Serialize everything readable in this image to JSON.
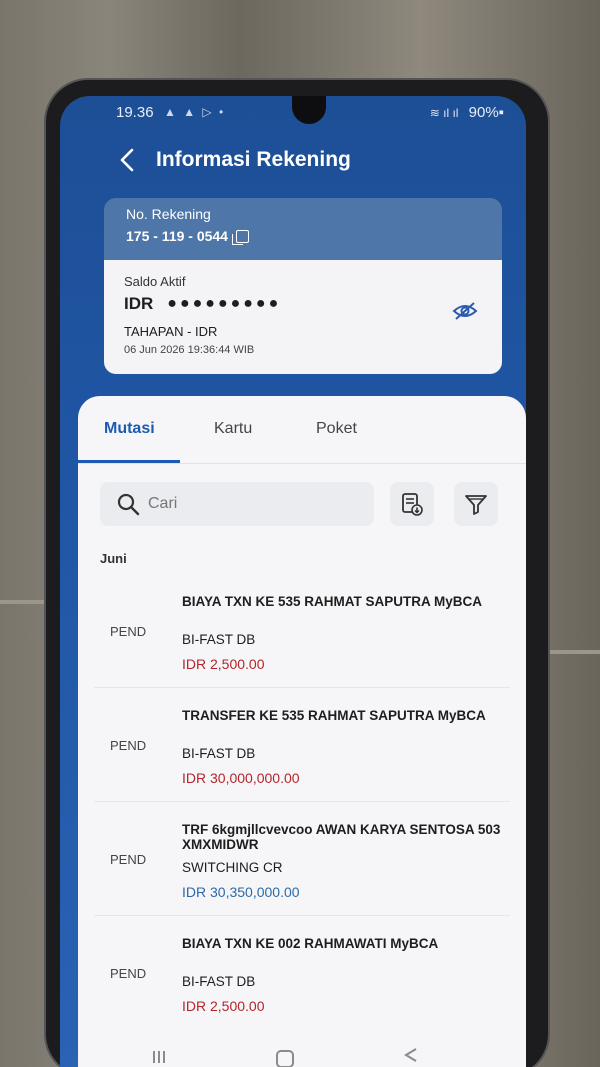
{
  "status_bar": {
    "time": "19.36",
    "icons": "▲ ▲ ▷ •",
    "signal": "≋ ıl ıl",
    "battery": "90%▪"
  },
  "header": {
    "title": "Informasi Rekening",
    "back_icon": "chevron-left-icon"
  },
  "account": {
    "number_label": "No. Rekening",
    "number": "175 - 119 - 0544",
    "balance_label": "Saldo Aktif",
    "currency": "IDR",
    "balance_masked": "●●●●●●●●●",
    "account_type": "TAHAPAN - IDR",
    "timestamp": "06 Jun 2026 19:36:44 WIB"
  },
  "tabs": [
    {
      "label": "Mutasi",
      "active": true
    },
    {
      "label": "Kartu",
      "active": false
    },
    {
      "label": "Poket",
      "active": false
    }
  ],
  "search": {
    "placeholder": "Cari",
    "value": ""
  },
  "month": "Juni",
  "transactions": [
    {
      "status": "PEND",
      "description": "BIAYA TXN  KE 535 RAHMAT SAPUTRA MyBCA",
      "type": "BI-FAST DB",
      "amount": "IDR 2,500.00",
      "direction": "debit"
    },
    {
      "status": "PEND",
      "description": "TRANSFER   KE 535 RAHMAT SAPUTRA MyBCA",
      "type": "BI-FAST DB",
      "amount": "IDR 30,000,000.00",
      "direction": "debit"
    },
    {
      "status": "PEND",
      "description": "TRF 6kgmjllcvevcoo AWAN KARYA SENTOSA 503  XMXMIDWR",
      "type": "SWITCHING CR",
      "amount": "IDR 30,350,000.00",
      "direction": "credit"
    },
    {
      "status": "PEND",
      "description": "BIAYA TXN  KE 002 RAHMAWATI MyBCA",
      "type": "BI-FAST DB",
      "amount": "IDR 2,500.00",
      "direction": "debit"
    }
  ],
  "colors": {
    "brand_blue": "#1d5bb3",
    "debit_red": "#b3262b",
    "credit_blue": "#2a6aa8"
  }
}
